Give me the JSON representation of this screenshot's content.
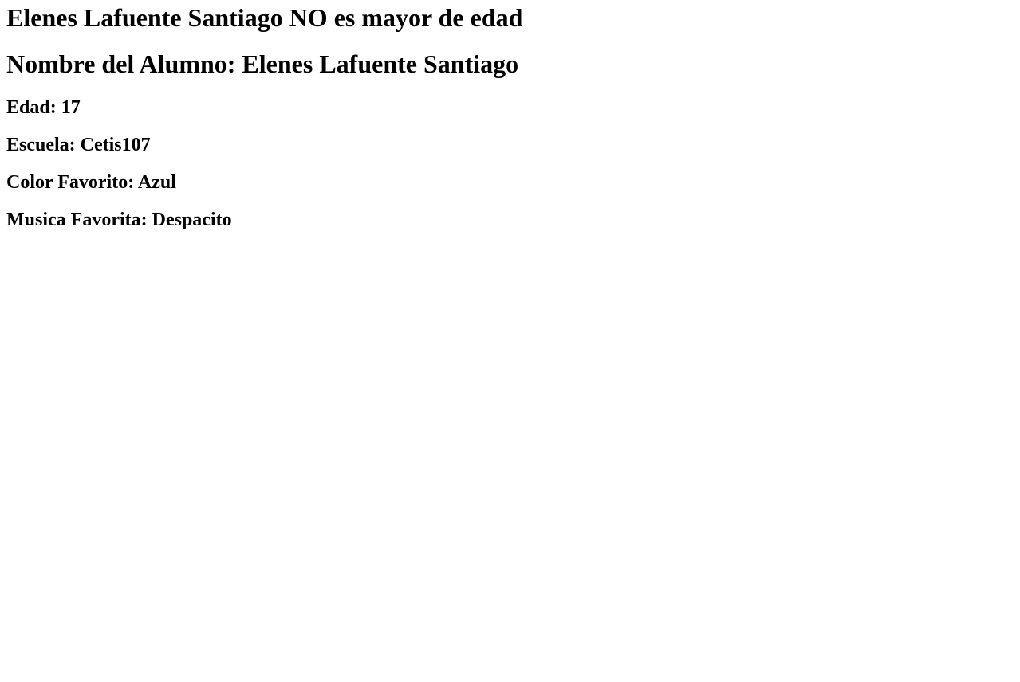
{
  "status_message": "Elenes Lafuente Santiago NO es mayor de edad",
  "student_name_line": "Nombre del Alumno: Elenes Lafuente Santiago",
  "details": {
    "age_line": "Edad: 17",
    "school_line": "Escuela: Cetis107",
    "favorite_color_line": "Color Favorito: Azul",
    "favorite_music_line": "Musica Favorita: Despacito"
  }
}
